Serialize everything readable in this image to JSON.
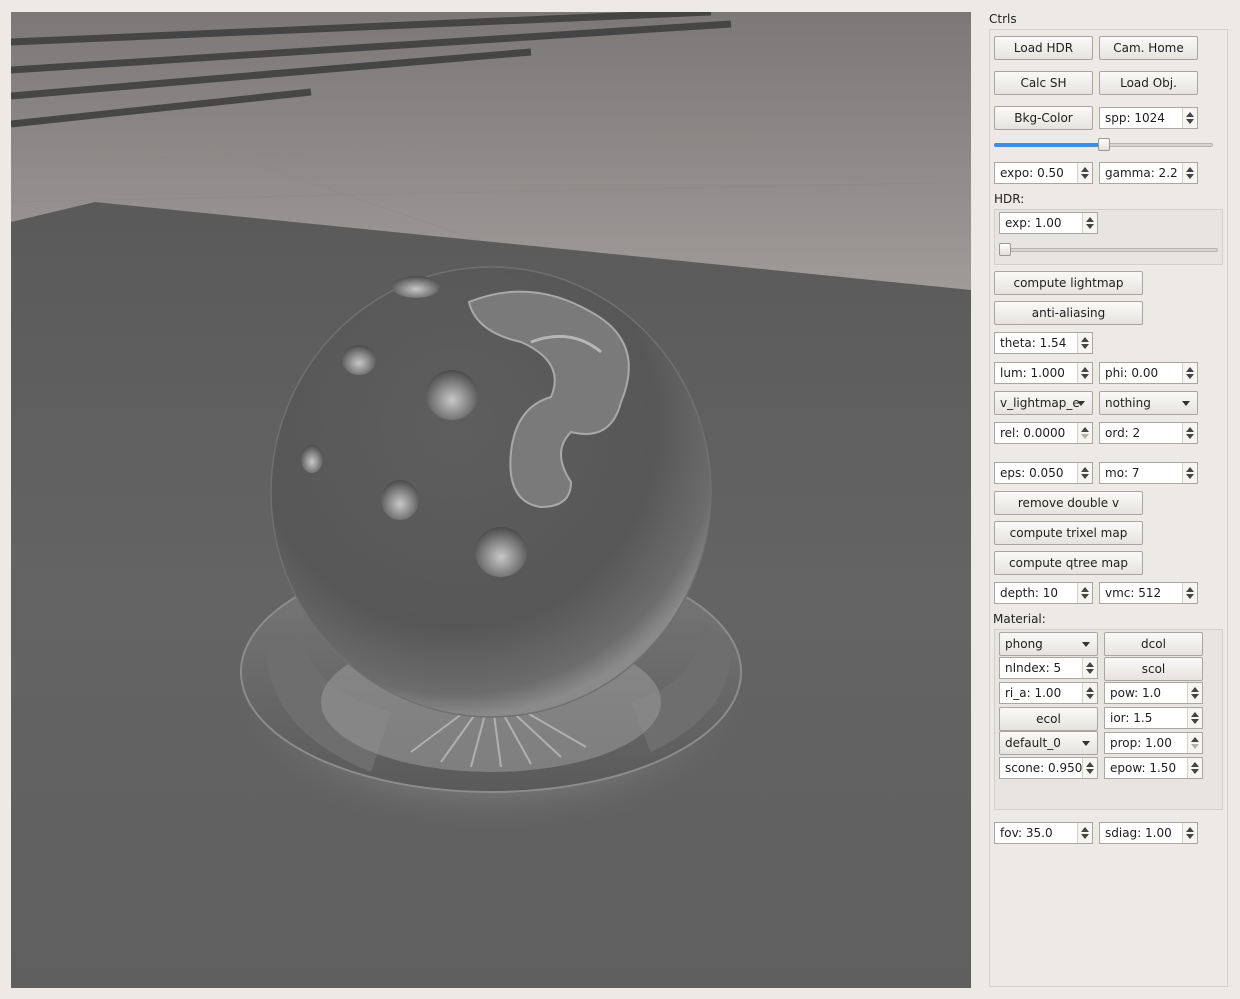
{
  "panel": {
    "title": "Ctrls",
    "buttons": {
      "load_hdr": "Load HDR",
      "cam_home": "Cam. Home",
      "calc_sh": "Calc SH",
      "load_obj": "Load Obj.",
      "bkg_color": "Bkg-Color",
      "compute_lightmap": "compute lightmap",
      "anti_aliasing": "anti-aliasing",
      "remove_double_v": "remove double v",
      "compute_trixel_map": "compute trixel map",
      "compute_qtree_map": "compute qtree map"
    },
    "spp": "spp: 1024",
    "spp_slider_fraction": 0.5,
    "expo": "expo: 0.50",
    "gamma": "gamma: 2.2",
    "hdr": {
      "label": "HDR:",
      "exp": "exp: 1.00",
      "exp_slider_fraction": 0.0
    },
    "theta": "theta: 1.54",
    "lum": "lum: 1.000",
    "phi": "phi: 0.00",
    "mode_select": "v_lightmap_e",
    "target_select": "nothing",
    "rel": "rel: 0.0000",
    "ord": "ord: 2",
    "eps": "eps: 0.050",
    "mo": "mo: 7",
    "depth": "depth: 10",
    "vmc": "vmc: 512",
    "material": {
      "label": "Material:",
      "shader_select": "phong",
      "dcol": "dcol",
      "nindex": "nIndex: 5",
      "scol": "scol",
      "ri_a": "ri_a: 1.00",
      "pow": "pow: 1.0",
      "ecol": "ecol",
      "ior": "ior: 1.5",
      "default_select": "default_0",
      "prop": "prop: 1.00",
      "scone": "scone: 0.950",
      "epow": "epow: 1.50"
    },
    "fov": "fov: 35.0",
    "sdiag": "sdiag: 1.00"
  },
  "colors": {
    "accent": "#3d8ee0",
    "panel_bg": "#edeae5"
  }
}
